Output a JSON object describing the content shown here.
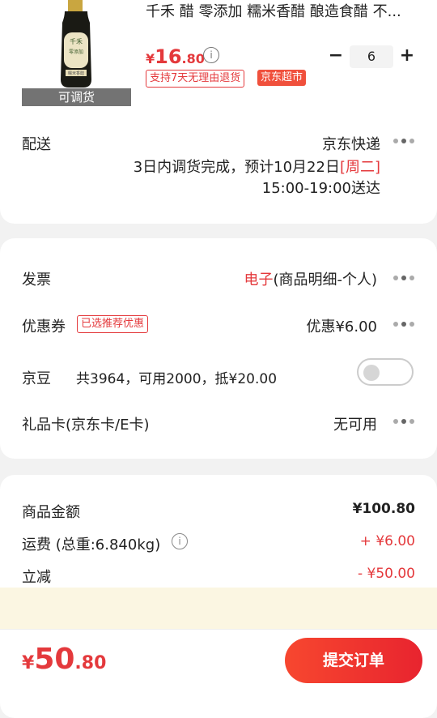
{
  "product": {
    "title": "千禾 醋 零添加 糯米香醋 酿造食醋 不...",
    "image_caption": "可调货",
    "bottle_brand": "千禾",
    "bottle_label": "零添加",
    "bottle_sub": "糯米香醋",
    "price_symbol": "¥",
    "price_int": "16",
    "price_dec": ".80",
    "quantity": "6",
    "minus": "−",
    "plus": "+",
    "tag_return": "支持7天无理由退货",
    "tag_store": "京东超市",
    "info_icon": "i"
  },
  "delivery": {
    "label": "配送",
    "carrier": "京东快递",
    "line1": "3日内调货完成，预计10月22日",
    "weekday": "[周二]",
    "line2": "15:00-19:00送达"
  },
  "invoice": {
    "label": "发票",
    "value_highlight": "电子",
    "value_rest": "(商品明细-个人)"
  },
  "coupon": {
    "label": "优惠券",
    "badge": "已选推荐优惠",
    "value": "优惠¥6.00"
  },
  "jingdou": {
    "label": "京豆",
    "detail": "共3964，可用2000，抵¥20.00",
    "toggle_on": false
  },
  "giftcard": {
    "label": "礼品卡(京东卡/E卡)",
    "value": "无可用"
  },
  "summary": {
    "goods_label": "商品金额",
    "goods_value": "¥100.80",
    "shipping_label": "运费 (总重:6.840kg)",
    "shipping_value": "+ ¥6.00",
    "discount_label": "立减",
    "discount_value": "- ¥50.00"
  },
  "footer": {
    "total_symbol": "¥",
    "total_int": "50",
    "total_dec": ".80",
    "submit_label": "提交订单"
  },
  "colors": {
    "accent": "#e4393c",
    "submit_gradient_start": "#f7472f",
    "submit_gradient_end": "#e8242f"
  }
}
